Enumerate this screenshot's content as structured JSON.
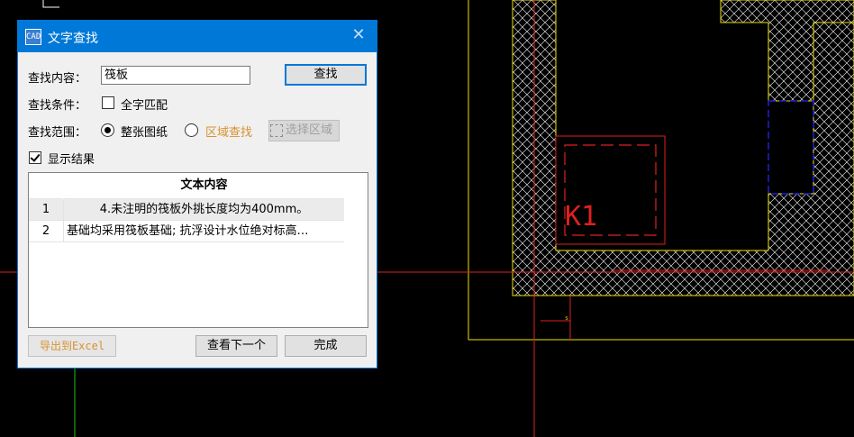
{
  "window": {
    "title": "文字查找",
    "icon": "cad-app-icon",
    "close_glyph": "✕"
  },
  "search": {
    "label": "查找内容：",
    "value": "筏板",
    "find_button": "查找"
  },
  "condition": {
    "label": "查找条件：",
    "whole_word_label": "全字匹配",
    "whole_word_checked": false
  },
  "scope": {
    "label": "查找范围：",
    "options": [
      "整张图纸",
      "区域查找"
    ],
    "selected": "整张图纸",
    "select_area_button": "选择区域"
  },
  "show_results": {
    "label": "显示结果",
    "checked": true
  },
  "results": {
    "header": "文本内容",
    "rows": [
      {
        "index": "1",
        "text": "4.未注明的筏板外挑长度均为400mm。"
      },
      {
        "index": "2",
        "text": "基础均采用筏板基础; 抗浮设计水位绝对标高…"
      }
    ]
  },
  "footer": {
    "export_button": "导出到Excel",
    "next_button": "查看下一个",
    "done_button": "完成"
  },
  "canvas": {
    "label": "K1",
    "colors": {
      "yellow": "#f0e000",
      "red": "#e02020",
      "white": "#ffffff",
      "blue": "#2020d0",
      "green": "#20c020"
    }
  }
}
